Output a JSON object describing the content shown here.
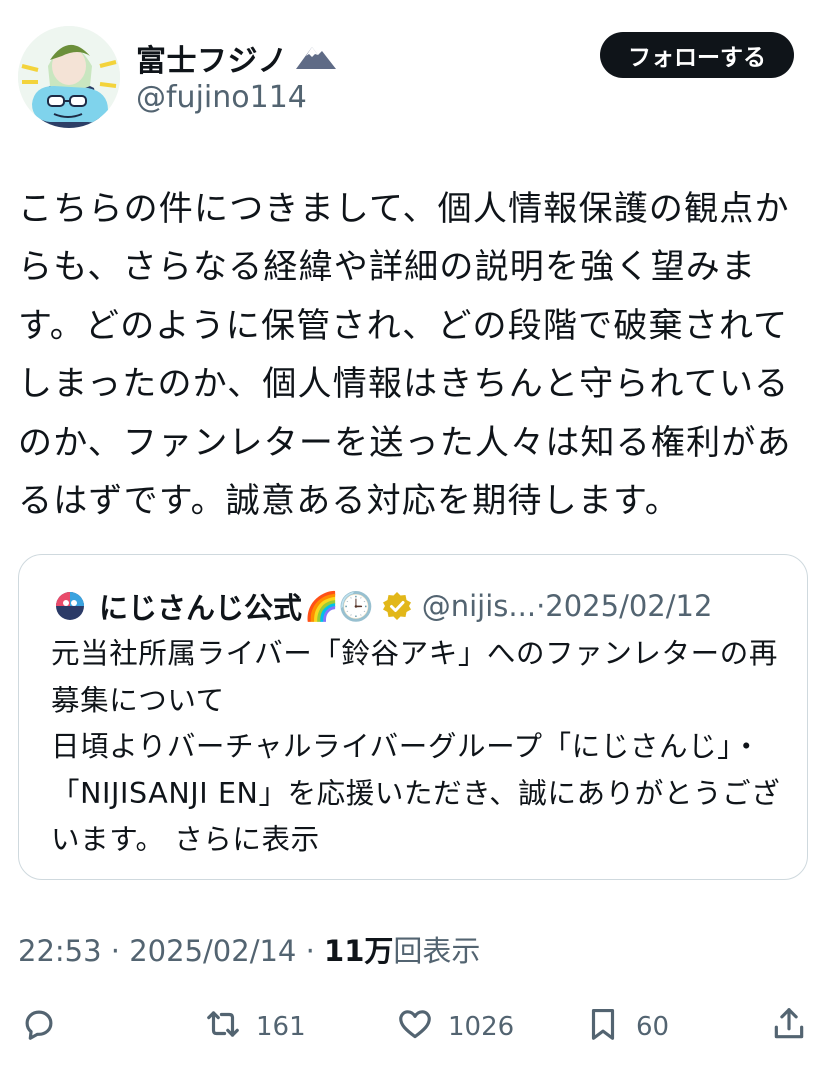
{
  "author": {
    "display_name": "富士フジノ",
    "name_emoji": "🗻",
    "handle": "@fujino114"
  },
  "follow_button": "フォローする",
  "tweet_text": "こちらの件につきまして、個人情報保護の観点からも、さらなる経緯や詳細の説明を強く望みます。どのように保管され、どの段階で破棄されてしまったのか、個人情報はきちんと守られているのか、ファンレターを送った人々は知る権利があるはずです。誠意ある対応を期待します。",
  "quoted": {
    "name": "にじさんじ公式",
    "emojis": "🌈🕒",
    "handle_date": "@nijis...·2025/02/12",
    "body": "元当社所属ライバー「鈴谷アキ」へのファンレターの再募集について\n日頃よりバーチャルライバーグループ「にじさんじ」・「NIJISANJI EN」を応援いただき、誠にありがとうございます。 さらに表示"
  },
  "meta": {
    "time_date": "22:53 · 2025/02/14 · ",
    "views_count": "11万",
    "views_label": "回表示"
  },
  "actions": {
    "retweets": "161",
    "likes": "1026",
    "bookmarks": "60"
  },
  "colors": {
    "text": "#0f1419",
    "secondary": "#536471",
    "border": "#cfd9de",
    "verified_gold": "#e2b719"
  }
}
